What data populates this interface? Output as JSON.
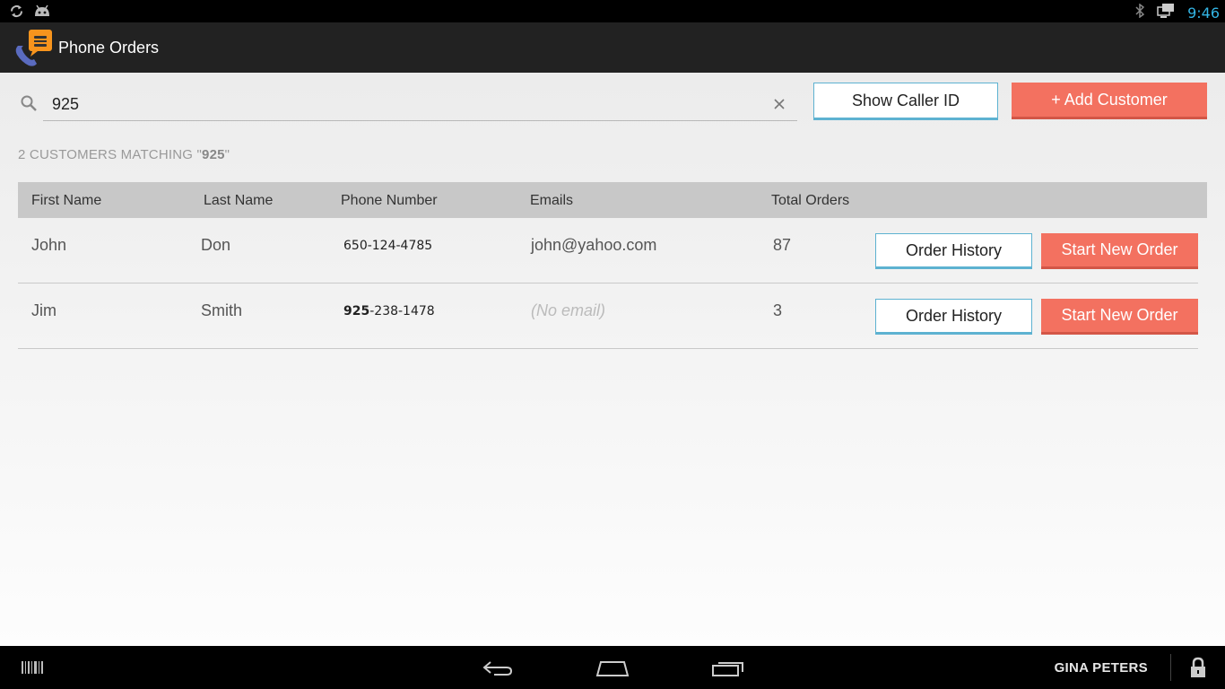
{
  "status_bar": {
    "time": "9:46",
    "icons": [
      "sync-icon",
      "android-icon",
      "bluetooth-icon",
      "network-icon"
    ]
  },
  "app": {
    "title": "Phone Orders",
    "logo_icon": "phone-orders-logo-icon"
  },
  "search": {
    "value": "925",
    "placeholder": ""
  },
  "buttons": {
    "show_caller_id": "Show Caller ID",
    "add_customer": "+ Add Customer"
  },
  "results": {
    "count": "2",
    "label_prefix": "CUSTOMERS MATCHING \"",
    "query": "925",
    "label_suffix": "\""
  },
  "table": {
    "headers": {
      "first_name": "First Name",
      "last_name": "Last Name",
      "phone": "Phone Number",
      "emails": "Emails",
      "total_orders": "Total Orders"
    },
    "rows": [
      {
        "first_name": "John",
        "last_name": "Don",
        "phone_match": "",
        "phone_rest": "650-124-4785",
        "email": "john@yahoo.com",
        "email_empty": false,
        "total_orders": "87",
        "history_label": "Order History",
        "new_order_label": "Start New Order"
      },
      {
        "first_name": "Jim",
        "last_name": "Smith",
        "phone_match": "925",
        "phone_rest": "-238-1478",
        "email": "(No email)",
        "email_empty": true,
        "total_orders": "3",
        "history_label": "Order History",
        "new_order_label": "Start New Order"
      }
    ]
  },
  "nav_bar": {
    "user": "GINA PETERS"
  },
  "colors": {
    "accent": "#f37160",
    "outline": "#5db2d1",
    "clock": "#33b5e5"
  }
}
